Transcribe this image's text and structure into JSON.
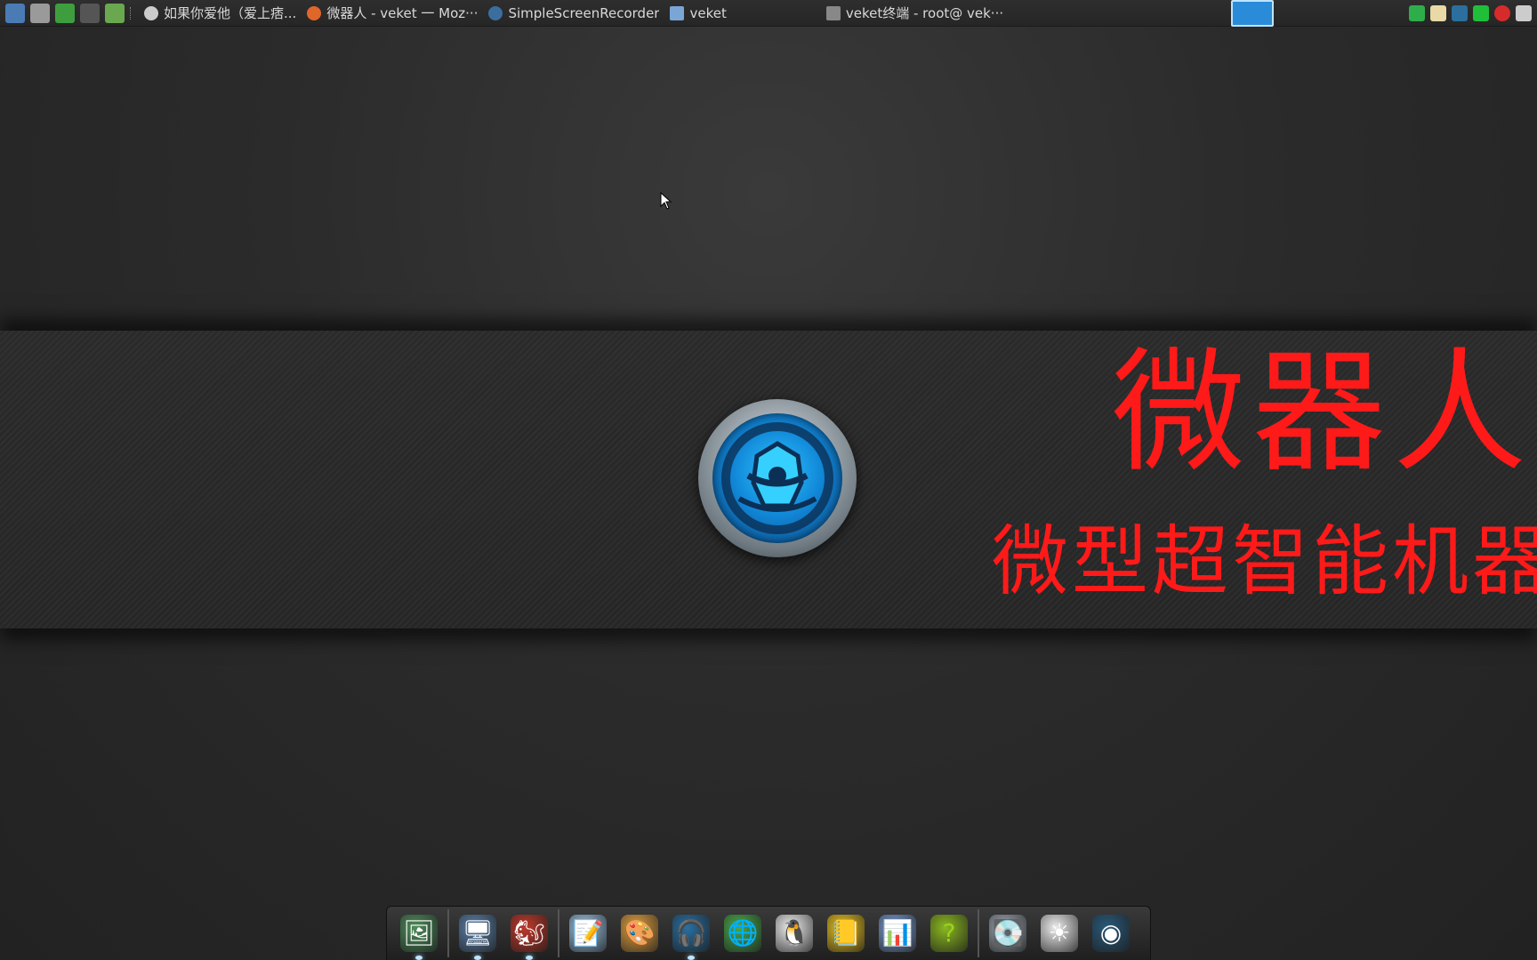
{
  "taskbar": {
    "launchers": [
      {
        "icon": "system-monitor-icon",
        "color": "#4a7bb5"
      },
      {
        "icon": "settings-tools-icon",
        "color": "#9a9a9a"
      },
      {
        "icon": "run-icon",
        "color": "#3e9e3e"
      },
      {
        "icon": "terminal-icon",
        "color": "#555555"
      },
      {
        "icon": "browser-globe-icon",
        "color": "#6aa84f"
      }
    ],
    "tasks": [
      {
        "label": "如果你爱他（爱上痞...",
        "icon": "media-player-icon",
        "color": "#cccccc"
      },
      {
        "label": "微器人 - veket 一 Moz···",
        "icon": "firefox-icon",
        "color": "#e0662a"
      },
      {
        "label": "SimpleScreenRecorder",
        "icon": "screen-recorder-icon",
        "color": "#3b6e9e"
      },
      {
        "label": "veket",
        "icon": "folder-icon",
        "color": "#7aa6d6"
      },
      {
        "label": "veket终端 - root@ vek···",
        "icon": "terminal-icon",
        "color": "#888888"
      }
    ],
    "tray": [
      {
        "icon": "shield-icon",
        "color": "#2eae4a"
      },
      {
        "icon": "clipboard-icon",
        "color": "#e8d9a6"
      },
      {
        "icon": "network-icon",
        "color": "#2b6f9e"
      },
      {
        "icon": "battery-icon",
        "color": "#1fbf3a"
      },
      {
        "icon": "record-icon",
        "color": "#d62b2b"
      },
      {
        "icon": "keyboard-icon",
        "color": "#cccccc"
      }
    ]
  },
  "banner": {
    "title": "微器人",
    "subtitle": "微型超智能机器",
    "accent_color": "#ff1a1a"
  },
  "dock": {
    "groups": [
      [
        {
          "icon": "file-manager-icon",
          "color": "#4e8c5a",
          "glyph": "🖼",
          "running": true
        }
      ],
      [
        {
          "icon": "computer-icon",
          "color": "#5a7fa8",
          "glyph": "🖥",
          "running": true
        },
        {
          "icon": "mascot-icon",
          "color": "#c0392b",
          "glyph": "🐿",
          "running": true
        }
      ],
      [
        {
          "icon": "text-editor-icon",
          "color": "#9cc2e0",
          "glyph": "📝",
          "running": false
        },
        {
          "icon": "paint-icon",
          "color": "#e0a040",
          "glyph": "🎨",
          "running": false
        },
        {
          "icon": "music-player-icon",
          "color": "#2a6fa0",
          "glyph": "🎧",
          "running": true
        },
        {
          "icon": "network-user-icon",
          "color": "#4aa84a",
          "glyph": "🌐",
          "running": false
        },
        {
          "icon": "qq-penguin-icon",
          "color": "#f0f0f0",
          "glyph": "🐧",
          "running": false
        },
        {
          "icon": "notebook-icon",
          "color": "#e8c020",
          "glyph": "📒",
          "running": false
        },
        {
          "icon": "chart-icon",
          "color": "#7a9ad0",
          "glyph": "📊",
          "running": false
        },
        {
          "icon": "help-icon",
          "color": "#8ab820",
          "glyph": "?",
          "running": false
        }
      ],
      [
        {
          "icon": "drive-icon",
          "color": "#9aa6b0",
          "glyph": "💽",
          "running": false
        },
        {
          "icon": "brightness-icon",
          "color": "#eeeeee",
          "glyph": "☀",
          "running": false
        },
        {
          "icon": "camera-icon",
          "color": "#2a5a7a",
          "glyph": "◉",
          "running": false
        }
      ]
    ]
  }
}
